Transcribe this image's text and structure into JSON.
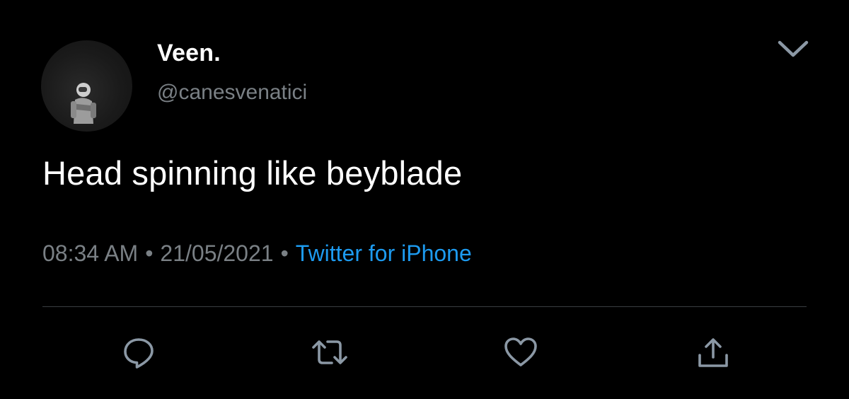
{
  "tweet": {
    "display_name": "Veen.",
    "handle": "@canesvenatici",
    "text": "Head spinning like beyblade",
    "time": "08:34 AM",
    "separator": "•",
    "date": "21/05/2021",
    "source": "Twitter for iPhone"
  },
  "icons": {
    "menu": "chevron-down-icon",
    "reply": "reply-icon",
    "retweet": "retweet-icon",
    "like": "heart-icon",
    "share": "share-icon"
  },
  "colors": {
    "background": "#000000",
    "primary_text": "#ffffff",
    "secondary_text": "#7a8085",
    "link": "#1d9bf0",
    "divider": "#3a3e42",
    "icon": "#8b98a5"
  }
}
